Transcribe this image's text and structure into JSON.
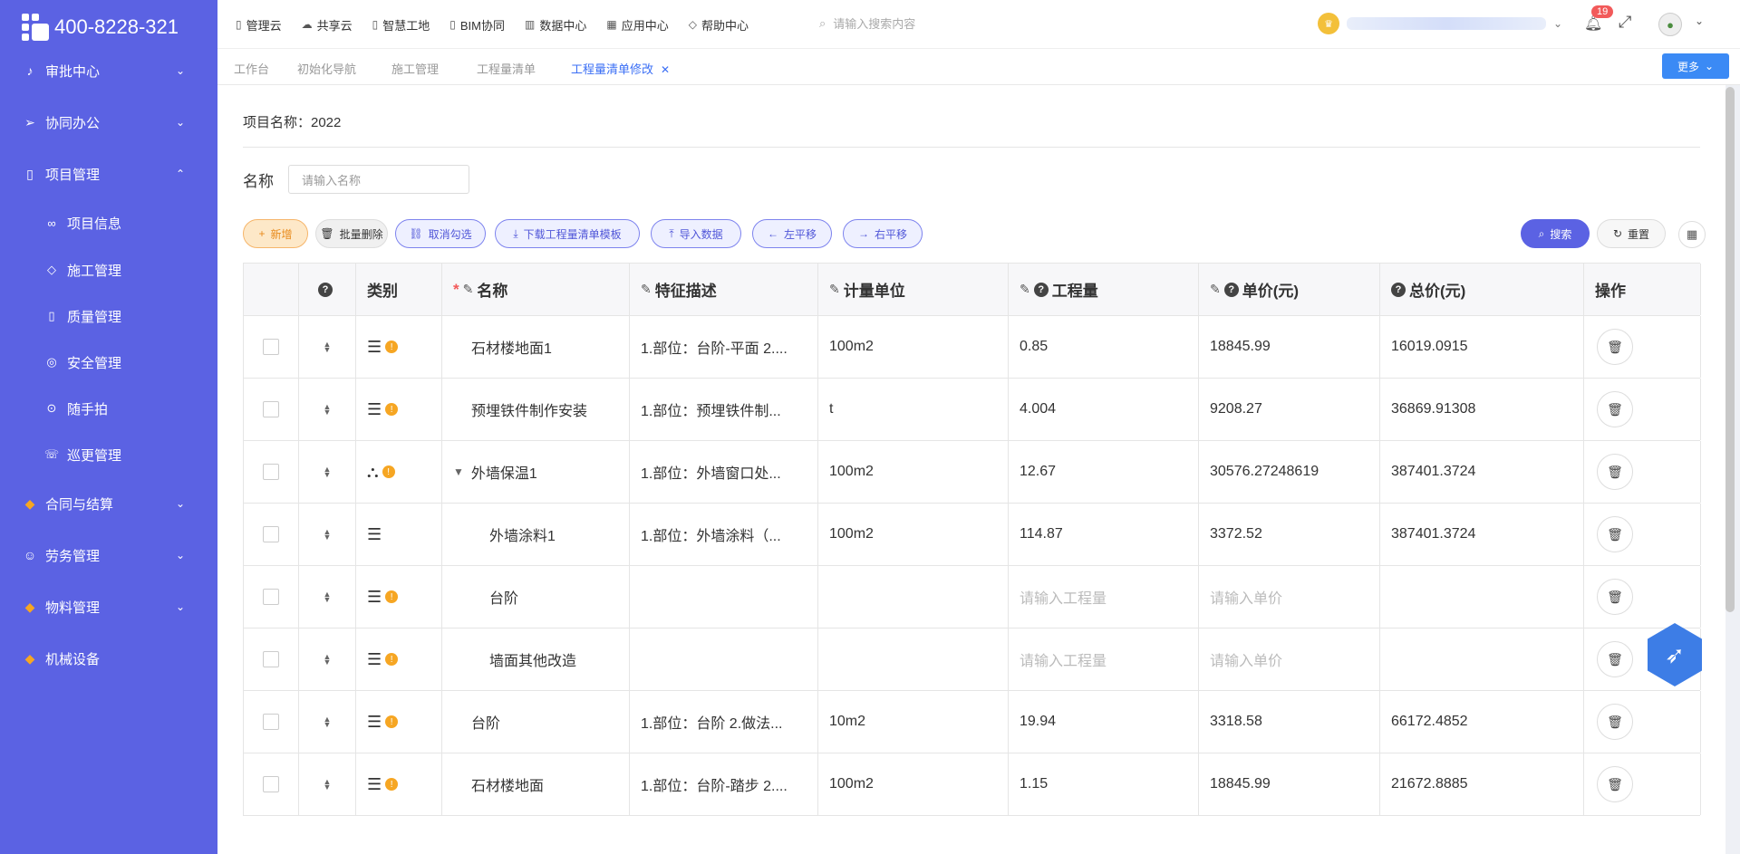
{
  "brand": {
    "phone": "400-8228-321"
  },
  "sidebar": {
    "items": [
      {
        "label": "审批中心",
        "icon": "bell-icon",
        "glyph": "♪",
        "chev": "⌄"
      },
      {
        "label": "协同办公",
        "icon": "send-icon",
        "glyph": "➢",
        "chev": "⌄"
      },
      {
        "label": "项目管理",
        "icon": "book-icon",
        "glyph": "▯",
        "chev": "⌃"
      },
      {
        "label": "合同与结算",
        "icon": "gem-icon",
        "glyph": "◆",
        "chev": "⌄"
      },
      {
        "label": "劳务管理",
        "icon": "user-icon",
        "glyph": "☺",
        "chev": "⌄"
      },
      {
        "label": "物料管理",
        "icon": "gem-icon",
        "glyph": "◆",
        "chev": "⌄"
      },
      {
        "label": "机械设备",
        "icon": "gem-icon",
        "glyph": "◆",
        "chev": ""
      }
    ],
    "subitems": [
      {
        "label": "项目信息",
        "glyph": "∞"
      },
      {
        "label": "施工管理",
        "glyph": "◇"
      },
      {
        "label": "质量管理",
        "glyph": "▯"
      },
      {
        "label": "安全管理",
        "glyph": "◎"
      },
      {
        "label": "随手拍",
        "glyph": "⊙"
      },
      {
        "label": "巡更管理",
        "glyph": "☏"
      }
    ]
  },
  "topnav": [
    "管理云",
    "共享云",
    "智慧工地",
    "BIM协同",
    "数据中心",
    "应用中心",
    "帮助中心"
  ],
  "search": {
    "placeholder": "请输入搜索内容"
  },
  "notifications": {
    "count": "19"
  },
  "tabs": [
    "工作台",
    "初始化导航",
    "施工管理",
    "工程量清单",
    "工程量清单修改"
  ],
  "more_label": "更多",
  "project": {
    "label": "项目名称：2022"
  },
  "filter": {
    "name_label": "名称",
    "name_placeholder": "请输入名称"
  },
  "toolbar": {
    "add": "新增",
    "batch_delete": "批量删除",
    "cancel_select": "取消勾选",
    "download_template": "下载工程量清单模板",
    "import": "导入数据",
    "shift_left": "左平移",
    "shift_right": "右平移",
    "search": "搜索",
    "reset": "重置"
  },
  "table": {
    "headers": {
      "type": "类别",
      "name": "名称",
      "desc": "特征描述",
      "unit": "计量单位",
      "qty": "工程量",
      "price": "单价(元)",
      "total": "总价(元)",
      "ops": "操作"
    },
    "rows": [
      {
        "type_icon": "list-icon",
        "warn": true,
        "name": "石材楼地面1",
        "indent": 0,
        "desc": "1.部位：台阶-平面 2....",
        "unit": "100m2",
        "qty": "0.85",
        "price": "18845.99",
        "total": "16019.0915"
      },
      {
        "type_icon": "list-icon",
        "warn": true,
        "name": "预埋铁件制作安装",
        "indent": 0,
        "desc": "1.部位：预埋铁件制...",
        "unit": "t",
        "qty": "4.004",
        "price": "9208.27",
        "total": "36869.91308"
      },
      {
        "type_icon": "tree-icon",
        "warn": true,
        "name": "外墙保温1",
        "indent": 0,
        "expand": true,
        "desc": "1.部位：外墙窗口处...",
        "unit": "100m2",
        "qty": "12.67",
        "price": "30576.27248619",
        "total": "387401.3724"
      },
      {
        "type_icon": "list-icon",
        "warn": false,
        "name": "外墙涂料1",
        "indent": 1,
        "desc": "1.部位：外墙涂料（...",
        "unit": "100m2",
        "qty": "114.87",
        "price": "3372.52",
        "total": "387401.3724"
      },
      {
        "type_icon": "list-icon",
        "warn": true,
        "name": "台阶",
        "indent": 1,
        "desc": "",
        "unit": "",
        "qty_ph": "请输入工程量",
        "price_ph": "请输入单价",
        "total": ""
      },
      {
        "type_icon": "list-icon",
        "warn": true,
        "name": "墙面其他改造",
        "indent": 1,
        "desc": "",
        "unit": "",
        "qty_ph": "请输入工程量",
        "price_ph": "请输入单价",
        "total": ""
      },
      {
        "type_icon": "list-icon",
        "warn": true,
        "name": "台阶",
        "indent": 0,
        "desc": "1.部位：台阶 2.做法...",
        "unit": "10m2",
        "qty": "19.94",
        "price": "3318.58",
        "total": "66172.4852"
      },
      {
        "type_icon": "list-icon",
        "warn": true,
        "name": "石材楼地面",
        "indent": 0,
        "desc": "1.部位：台阶-踏步 2....",
        "unit": "100m2",
        "qty": "1.15",
        "price": "18845.99",
        "total": "21672.8885"
      }
    ]
  }
}
